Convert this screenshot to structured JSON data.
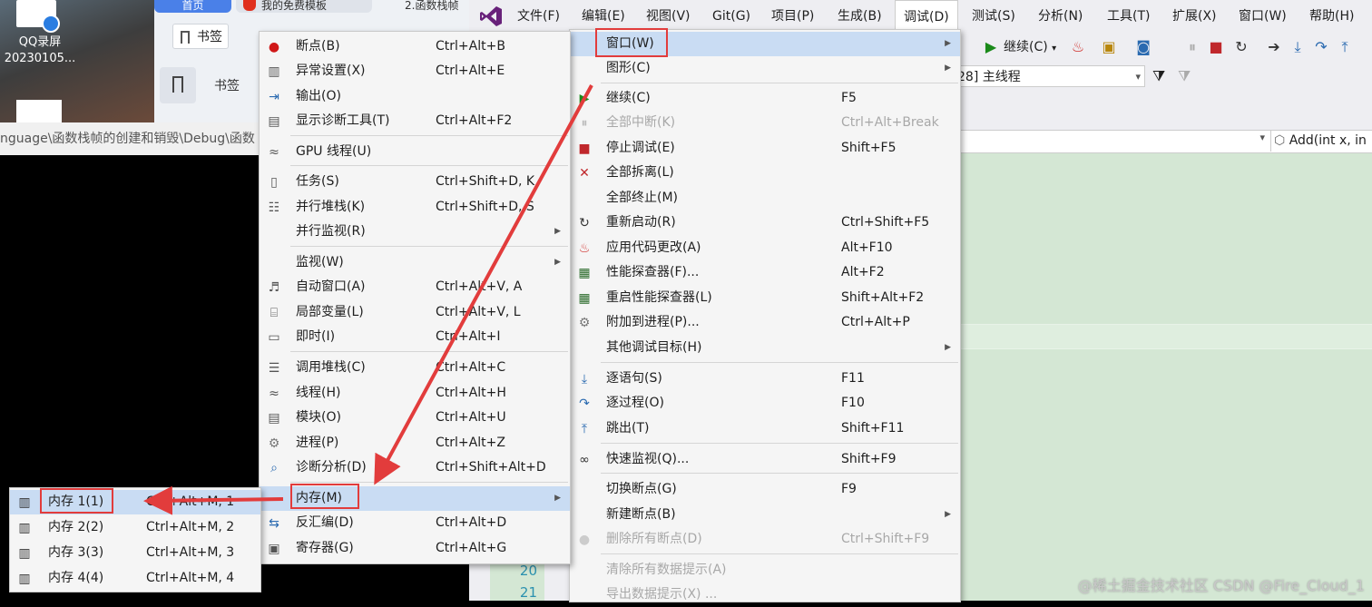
{
  "desktop": {
    "icon_label_1": "QQ录屏",
    "icon_label_2": "20230105..."
  },
  "browser": {
    "tabs": [
      "首页",
      "我的免费模板",
      "2.函数栈帧"
    ],
    "bookmark_btn": "书签",
    "bookmark_side": "书签",
    "path": "nguage\\函数栈帧的创建和销毁\\Debug\\函数"
  },
  "vs": {
    "menubar": [
      "文件(F)",
      "编辑(E)",
      "视图(V)",
      "Git(G)",
      "项目(P)",
      "生成(B)",
      "调试(D)",
      "测试(S)",
      "分析(N)",
      "工具(T)",
      "扩展(X)",
      "窗口(W)",
      "帮助(H)"
    ],
    "toolbar_continue": "继续(C)",
    "thread": "28] 主线程",
    "function": "Add(int x, in",
    "line_numbers": [
      "20",
      "21"
    ]
  },
  "debug_menu": {
    "items": [
      {
        "label": "窗口(W)",
        "shortcut": "",
        "icon": "blank",
        "submenu": true,
        "highlighted": true
      },
      {
        "label": "图形(C)",
        "shortcut": "",
        "icon": "blank",
        "submenu": true
      },
      {
        "label": "继续(C)",
        "shortcut": "F5",
        "icon": "play-icon"
      },
      {
        "label": "全部中断(K)",
        "shortcut": "Ctrl+Alt+Break",
        "icon": "pause-icon",
        "disabled": true
      },
      {
        "label": "停止调试(E)",
        "shortcut": "Shift+F5",
        "icon": "stop-icon"
      },
      {
        "label": "全部拆离(L)",
        "shortcut": "",
        "icon": "x-icon"
      },
      {
        "label": "全部终止(M)",
        "shortcut": "",
        "icon": "blank"
      },
      {
        "label": "重新启动(R)",
        "shortcut": "Ctrl+Shift+F5",
        "icon": "restart-icon"
      },
      {
        "label": "应用代码更改(A)",
        "shortcut": "Alt+F10",
        "icon": "flame-icon"
      },
      {
        "label": "性能探查器(F)...",
        "shortcut": "Alt+F2",
        "icon": "profiler-icon"
      },
      {
        "label": "重启性能探查器(L)",
        "shortcut": "Shift+Alt+F2",
        "icon": "profiler-icon"
      },
      {
        "label": "附加到进程(P)...",
        "shortcut": "Ctrl+Alt+P",
        "icon": "gears-icon"
      },
      {
        "label": "其他调试目标(H)",
        "shortcut": "",
        "icon": "blank",
        "submenu": true
      },
      {
        "label": "逐语句(S)",
        "shortcut": "F11",
        "icon": "step-into-icon"
      },
      {
        "label": "逐过程(O)",
        "shortcut": "F10",
        "icon": "step-over-icon"
      },
      {
        "label": "跳出(T)",
        "shortcut": "Shift+F11",
        "icon": "step-out-icon"
      },
      {
        "label": "快速监视(Q)...",
        "shortcut": "Shift+F9",
        "icon": "glasses-icon"
      },
      {
        "label": "切换断点(G)",
        "shortcut": "F9",
        "icon": "blank"
      },
      {
        "label": "新建断点(B)",
        "shortcut": "",
        "icon": "blank",
        "submenu": true
      },
      {
        "label": "删除所有断点(D)",
        "shortcut": "Ctrl+Shift+F9",
        "icon": "breakpoints-icon",
        "disabled": true
      },
      {
        "label": "清除所有数据提示(A)",
        "shortcut": "",
        "icon": "blank",
        "disabled": true
      },
      {
        "label": "导出数据提示(X) ...",
        "shortcut": "",
        "icon": "blank",
        "disabled": true
      }
    ]
  },
  "windows_menu": {
    "items": [
      {
        "label": "断点(B)",
        "shortcut": "Ctrl+Alt+B",
        "icon": "breakpoint-icon"
      },
      {
        "label": "异常设置(X)",
        "shortcut": "Ctrl+Alt+E",
        "icon": "exception-icon"
      },
      {
        "label": "输出(O)",
        "shortcut": "",
        "icon": "output-icon"
      },
      {
        "label": "显示诊断工具(T)",
        "shortcut": "Ctrl+Alt+F2",
        "icon": "diagnostics-icon"
      },
      {
        "label": "GPU 线程(U)",
        "shortcut": "",
        "icon": "gpu-thread-icon"
      },
      {
        "label": "任务(S)",
        "shortcut": "Ctrl+Shift+D, K",
        "icon": "clipboard-icon"
      },
      {
        "label": "并行堆栈(K)",
        "shortcut": "Ctrl+Shift+D, S",
        "icon": "parallel-stacks-icon"
      },
      {
        "label": "并行监视(R)",
        "shortcut": "",
        "icon": "blank",
        "submenu": true
      },
      {
        "label": "监视(W)",
        "shortcut": "",
        "icon": "blank",
        "submenu": true
      },
      {
        "label": "自动窗口(A)",
        "shortcut": "Ctrl+Alt+V, A",
        "icon": "autos-icon"
      },
      {
        "label": "局部变量(L)",
        "shortcut": "Ctrl+Alt+V, L",
        "icon": "locals-icon"
      },
      {
        "label": "即时(I)",
        "shortcut": "Ctrl+Alt+I",
        "icon": "immediate-icon"
      },
      {
        "label": "调用堆栈(C)",
        "shortcut": "Ctrl+Alt+C",
        "icon": "call-stack-icon"
      },
      {
        "label": "线程(H)",
        "shortcut": "Ctrl+Alt+H",
        "icon": "threads-icon"
      },
      {
        "label": "模块(O)",
        "shortcut": "Ctrl+Alt+U",
        "icon": "modules-icon"
      },
      {
        "label": "进程(P)",
        "shortcut": "Ctrl+Alt+Z",
        "icon": "processes-icon"
      },
      {
        "label": "诊断分析(D)",
        "shortcut": "Ctrl+Shift+Alt+D",
        "icon": "diagnostic-analysis-icon"
      },
      {
        "label": "内存(M)",
        "shortcut": "",
        "icon": "blank",
        "submenu": true,
        "highlighted": true
      },
      {
        "label": "反汇编(D)",
        "shortcut": "Ctrl+Alt+D",
        "icon": "disassembly-icon"
      },
      {
        "label": "寄存器(G)",
        "shortcut": "Ctrl+Alt+G",
        "icon": "registers-icon"
      }
    ]
  },
  "memory_menu": {
    "items": [
      {
        "label": "内存 1(1)",
        "shortcut": "Ctrl+Alt+M, 1",
        "icon": "memory-chip-icon",
        "highlighted": true
      },
      {
        "label": "内存 2(2)",
        "shortcut": "Ctrl+Alt+M, 2",
        "icon": "memory-chip-icon"
      },
      {
        "label": "内存 3(3)",
        "shortcut": "Ctrl+Alt+M, 3",
        "icon": "memory-chip-icon"
      },
      {
        "label": "内存 4(4)",
        "shortcut": "Ctrl+Alt+M, 4",
        "icon": "memory-chip-icon"
      }
    ]
  },
  "watermark": "@稀土掘金技术社区 CSDN @Fire_Cloud_1",
  "colors": {
    "menu_highlight": "#c9dcf3",
    "annotation_red": "#e23c3c",
    "editor_bg": "#d4e7d4",
    "vs_purple": "#68217a"
  }
}
